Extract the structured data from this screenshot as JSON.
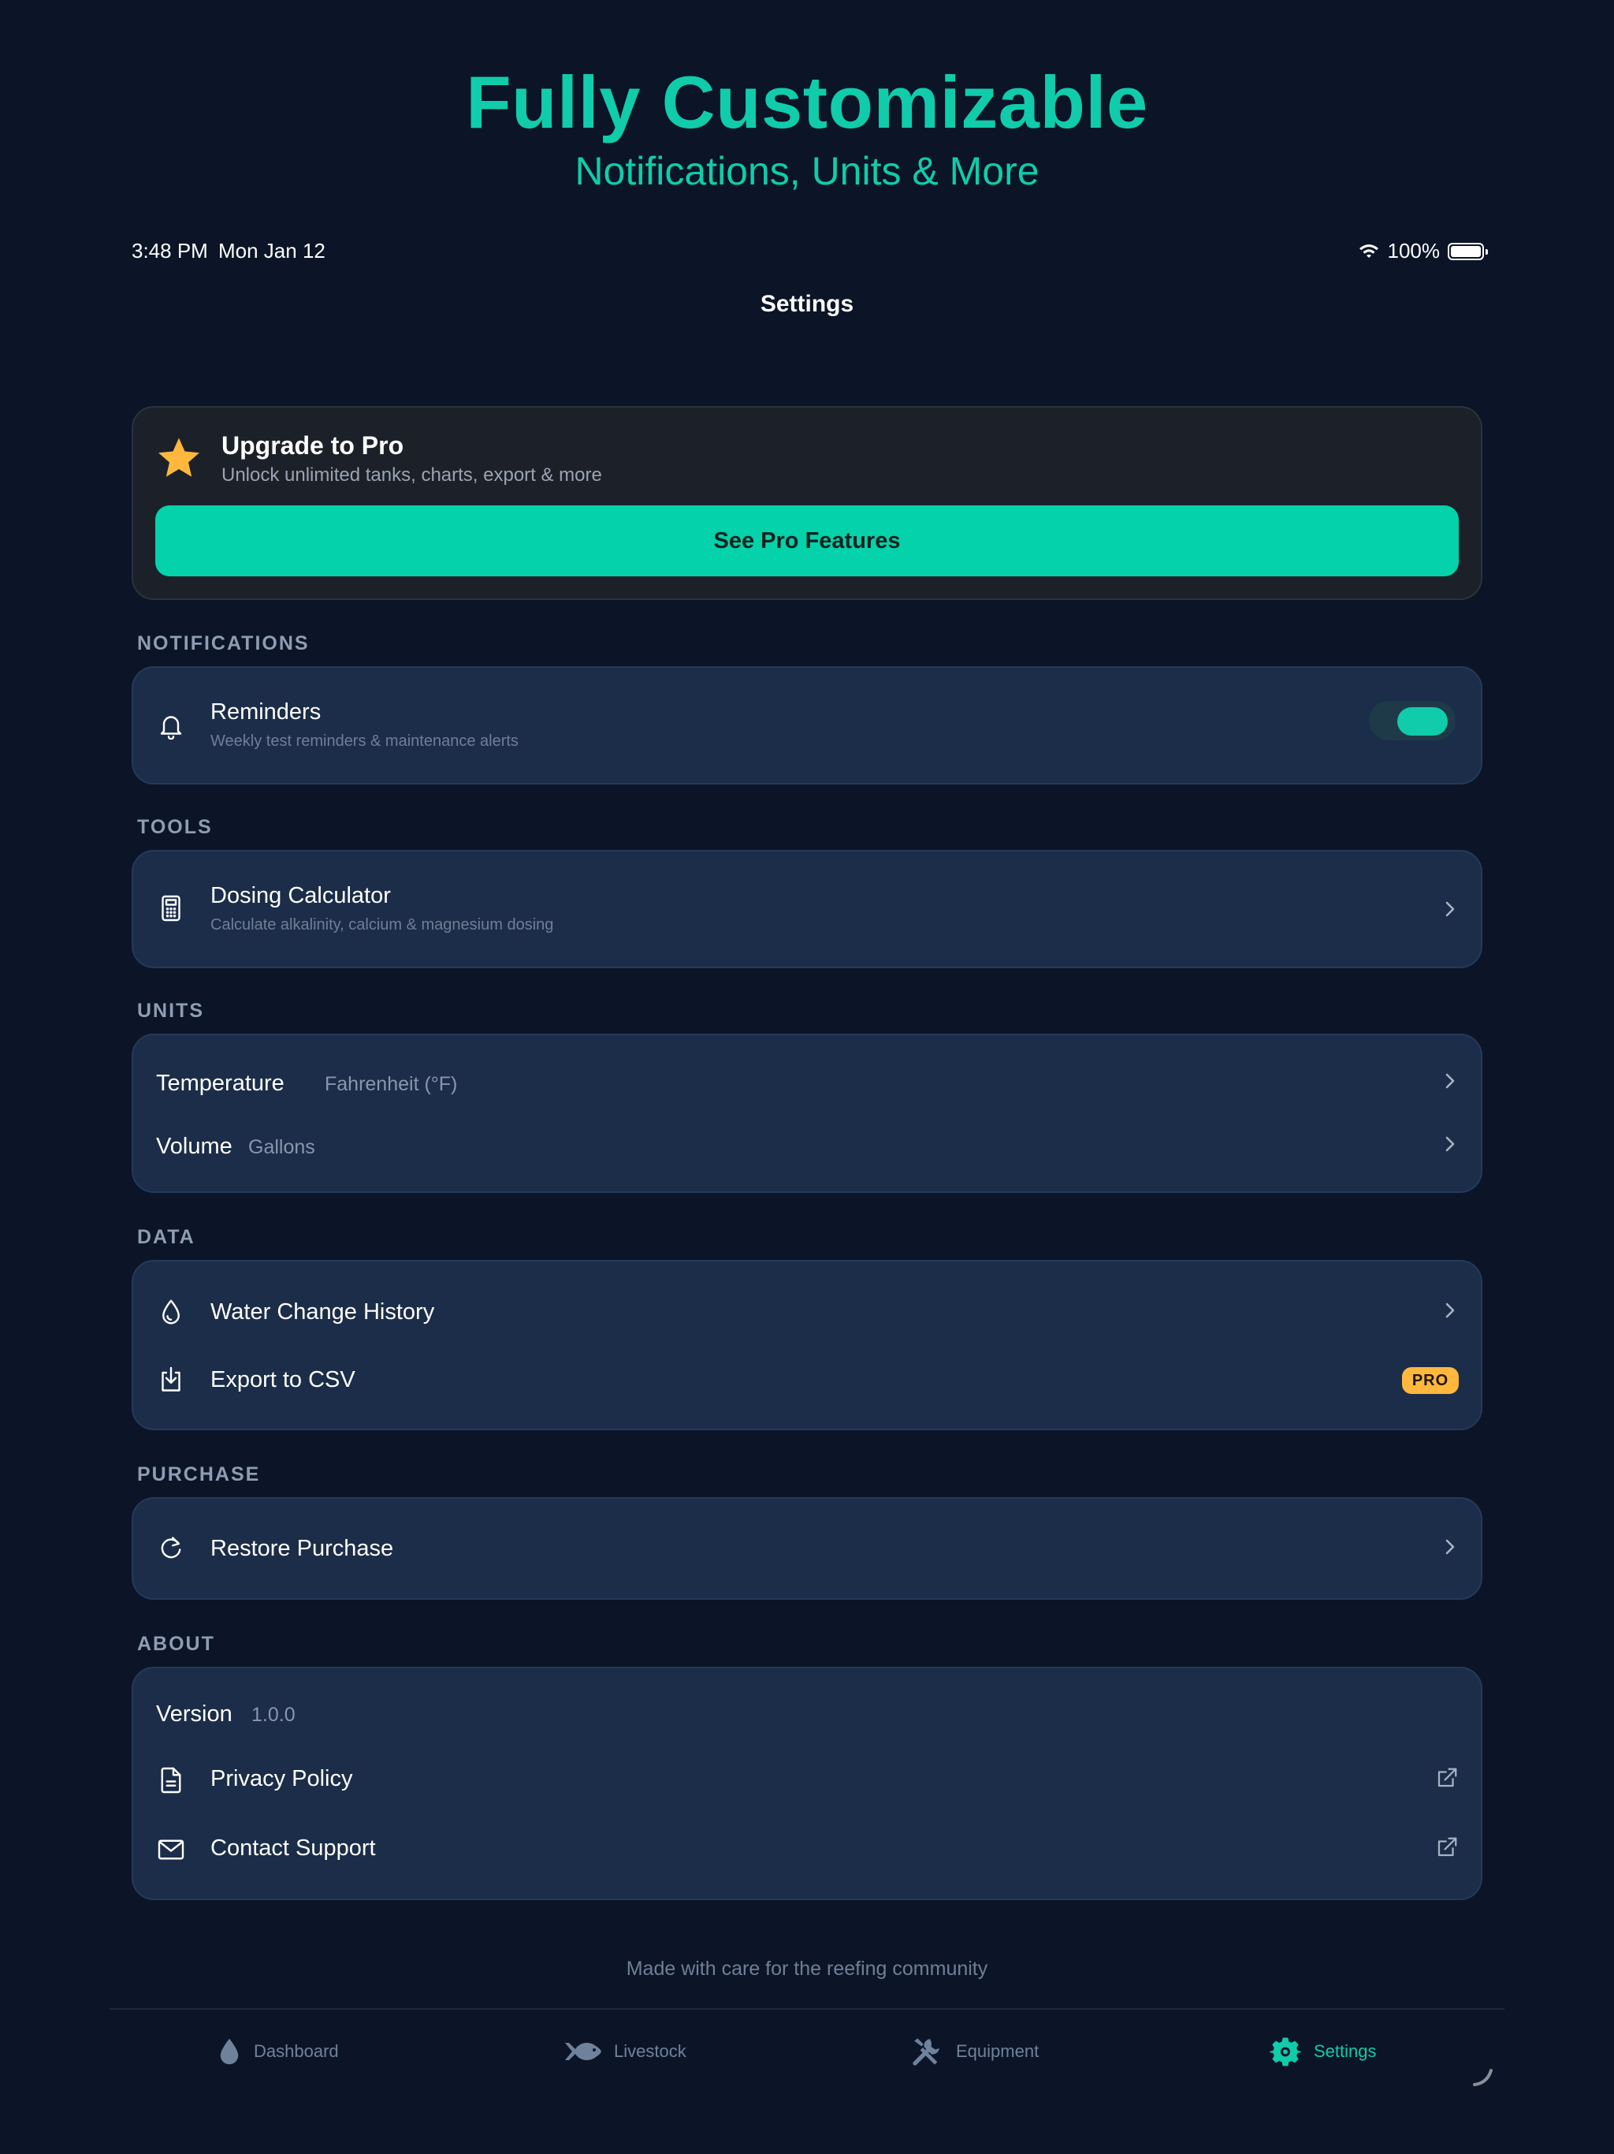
{
  "hero": {
    "title": "Fully Customizable",
    "subtitle": "Notifications, Units & More"
  },
  "status_bar": {
    "time": "3:48 PM",
    "date": "Mon Jan 12",
    "battery": "100%"
  },
  "nav": {
    "title": "Settings"
  },
  "pro_card": {
    "title": "Upgrade to Pro",
    "subtitle": "Unlock unlimited tanks, charts, export & more",
    "button": "See Pro Features"
  },
  "sections": {
    "notifications": {
      "label": "NOTIFICATIONS",
      "reminders": {
        "title": "Reminders",
        "subtitle": "Weekly test reminders & maintenance alerts",
        "enabled": true
      }
    },
    "tools": {
      "label": "TOOLS",
      "dosing": {
        "title": "Dosing Calculator",
        "subtitle": "Calculate alkalinity, calcium & magnesium dosing"
      }
    },
    "units": {
      "label": "UNITS",
      "temperature": {
        "label": "Temperature",
        "value": "Fahrenheit (°F)"
      },
      "volume": {
        "label": "Volume",
        "value": "Gallons"
      }
    },
    "data": {
      "label": "DATA",
      "water_change": {
        "title": "Water Change History"
      },
      "export": {
        "title": "Export to CSV",
        "badge": "PRO"
      }
    },
    "purchase": {
      "label": "PURCHASE",
      "restore": {
        "title": "Restore Purchase"
      }
    },
    "about": {
      "label": "ABOUT",
      "version": {
        "label": "Version",
        "value": "1.0.0"
      },
      "privacy": {
        "title": "Privacy Policy"
      },
      "support": {
        "title": "Contact Support"
      }
    }
  },
  "footer": {
    "note": "Made with care for the reefing community"
  },
  "tabs": [
    {
      "label": "Dashboard",
      "icon": "drop-icon",
      "active": false
    },
    {
      "label": "Livestock",
      "icon": "fish-icon",
      "active": false
    },
    {
      "label": "Equipment",
      "icon": "tools-icon",
      "active": false
    },
    {
      "label": "Settings",
      "icon": "gear-icon",
      "active": true
    }
  ],
  "colors": {
    "background": "#0b1527",
    "accent": "#10ccaa",
    "card": "#1b2d48",
    "pro_badge": "#ffb73d",
    "star": "#ffb73d"
  }
}
